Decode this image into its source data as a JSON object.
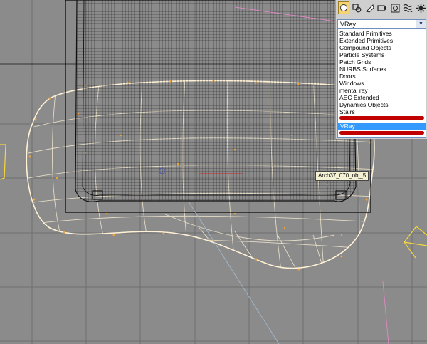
{
  "viewport": {
    "object_label": "Arch37_070_obj_5",
    "colors": {
      "background": "#8b8b8b",
      "grid": "#6f6f6f",
      "mesh": "#1a1a1a",
      "cushion": "#fff2d6",
      "cushion_vertices": "#f2a23a",
      "selection_box": "#000000",
      "gizmo_light": "#f7d73a"
    }
  },
  "command_panel": {
    "toolbar_icons": [
      "geometry-icon",
      "shapes-icon",
      "lights-icon",
      "cameras-icon",
      "helpers-icon",
      "spacewarps-icon",
      "systems-icon"
    ],
    "dropdown": {
      "selected": "VRay",
      "arrow": "▼"
    },
    "list": {
      "items": [
        "Standard Primitives",
        "Extended Primitives",
        "Compound Objects",
        "Particle Systems",
        "Patch Grids",
        "NURBS Surfaces",
        "Doors",
        "Windows",
        "mental ray",
        "AEC Extended",
        "Dynamics Objects",
        "Stairs"
      ],
      "selected": "VRay"
    },
    "colors": {
      "panel": "#cfcfcf",
      "highlight": "#3399ff",
      "annotation": "#c00000",
      "active_tab": "#f4d472"
    }
  }
}
